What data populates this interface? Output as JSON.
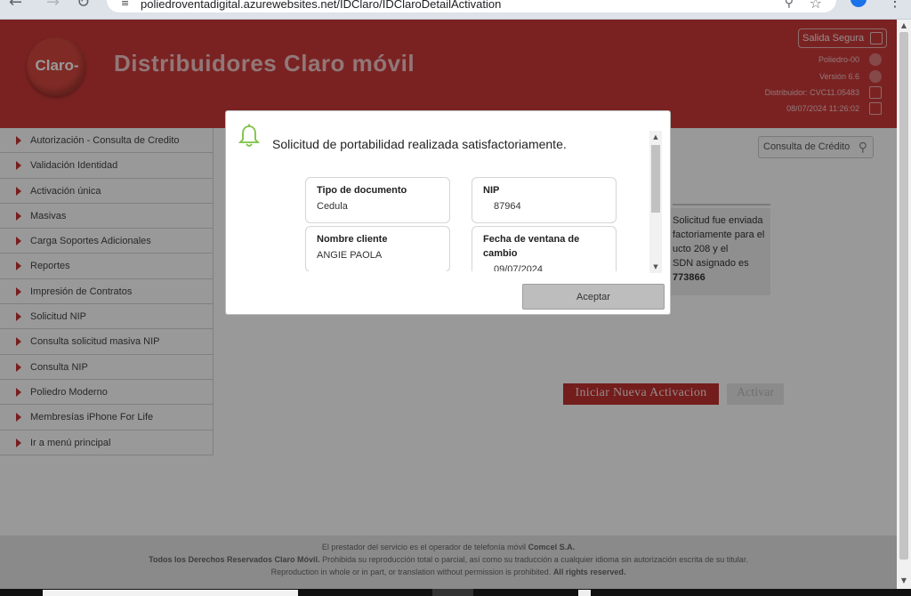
{
  "browser": {
    "url": "poliedroventadigital.azurewebsites.net/IDClaro/IDClaroDetailActivation"
  },
  "header": {
    "logo_text": "Claro-",
    "title": "Distribuidores Claro móvil",
    "salida_label": "Salida Segura",
    "poliedro": "Poliedro-00",
    "version": "Versión 6.6",
    "distribuidor": "Distribuidor: CVC11.05483",
    "datetime": "08/07/2024 11:26:02"
  },
  "sidebar": {
    "items": [
      {
        "label": "Autorización - Consulta de Credito"
      },
      {
        "label": "Validación Identidad"
      },
      {
        "label": "Activación única"
      },
      {
        "label": "Masivas"
      },
      {
        "label": "Carga Soportes Adicionales"
      },
      {
        "label": "Reportes"
      },
      {
        "label": "Impresión de Contratos"
      },
      {
        "label": "Solicitud NIP"
      },
      {
        "label": "Consulta solicitud masiva NIP"
      },
      {
        "label": "Consulta NIP"
      },
      {
        "label": "Poliedro Moderno"
      },
      {
        "label": "Membresías iPhone For Life"
      },
      {
        "label": "Ir a menú principal"
      }
    ]
  },
  "main": {
    "consulta_button": "Consulta de Crédito",
    "success_lines": [
      "Solicitud fue enviada",
      "factoriamente para el",
      "ucto 208 y el",
      "SDN asignado es"
    ],
    "msisdn": "773866",
    "iniciar_button": "Iniciar Nueva Activacion",
    "activar_button": "Activar"
  },
  "modal": {
    "message": "Solicitud de portabilidad realizada satisfactoriamente.",
    "fields": {
      "tipo_documento": {
        "label": "Tipo de documento",
        "value": "Cedula"
      },
      "nip": {
        "label": "NIP",
        "value": "87964"
      },
      "nombre_cliente": {
        "label": "Nombre cliente",
        "value": "ANGIE PAOLA"
      },
      "fecha_ventana": {
        "label": "Fecha de ventana de cambio",
        "value": "09/07/2024"
      }
    },
    "accept_button": "Aceptar"
  },
  "footer": {
    "line1_prefix": "El prestador del servicio es el operador de telefonía móvil",
    "line1_company": "Comcel S.A.",
    "line2_bold": "Todos los Derechos Reservados Claro Móvil.",
    "line2_rest": "Prohibida su reproducción total o parcial, así como su traducción a cualquier idioma sin autorización escrita de su titular.",
    "line3_prefix": "Reproduction in whole or in part, or translation without permission is prohibited.",
    "line3_bold": "All rights reserved."
  },
  "colors": {
    "brand_red": "#cc3a3a",
    "bell_green": "#7cc242"
  },
  "icons": [
    "back-arrow-icon",
    "forward-arrow-icon",
    "reload-icon",
    "site-settings-icon",
    "zoom-icon",
    "bookmark-star-icon",
    "profile-icon",
    "menu-kebab-icon",
    "lock-icon",
    "bell-icon",
    "search-key-icon"
  ]
}
